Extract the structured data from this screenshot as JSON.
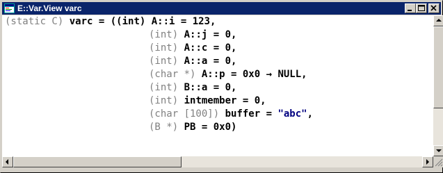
{
  "window": {
    "title": "E::Var.View varc",
    "icon": "app-window-icon",
    "controls": {
      "minimize": "minimize-icon",
      "maximize": "maximize-icon",
      "close": "close-icon"
    }
  },
  "lines": [
    {
      "prefix": "(static C)",
      "decl": "varc = ((int)",
      "name": "A::i = 123,"
    },
    {
      "type": "(int)",
      "name": "A::j = 0,"
    },
    {
      "type": "(int)",
      "name": "A::c = 0,"
    },
    {
      "type": "(int)",
      "name": "A::a = 0,"
    },
    {
      "type": "(char *)",
      "name": "A::p = 0x0 → NULL,"
    },
    {
      "type": "(int)",
      "name": "B::a = 0,"
    },
    {
      "type": "(int)",
      "name": "intmember = 0,"
    },
    {
      "type": "(char [100])",
      "name": "buffer = ",
      "value": "\"abc\"",
      "suffix": ","
    },
    {
      "type": "(B *)",
      "name": "PB = 0x0)"
    }
  ],
  "scrollbars": {
    "up": "scroll-up-icon",
    "down": "scroll-down-icon",
    "left": "scroll-left-icon",
    "right": "scroll-right-icon"
  }
}
